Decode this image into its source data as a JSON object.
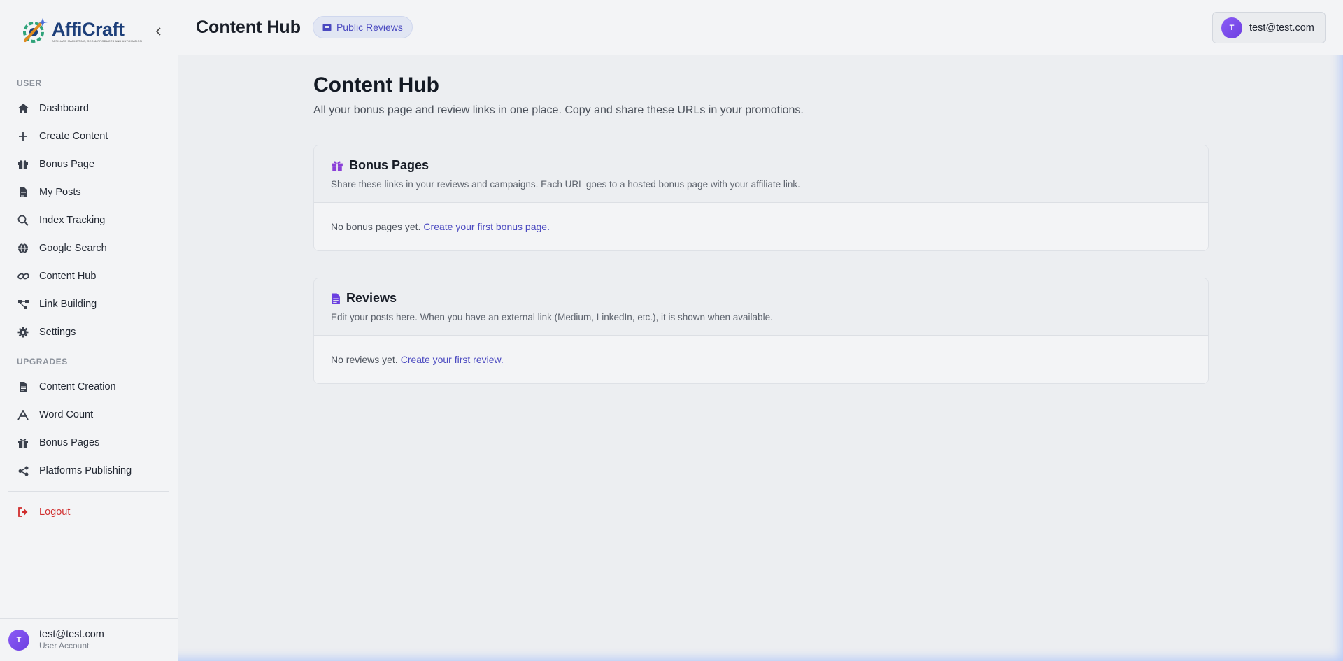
{
  "brand": {
    "name": "AffiCraft",
    "tagline": "AFFILIATE MARKETING, SEO & PRODUCTS AND AUTOMATION"
  },
  "sidebar": {
    "section_user": "USER",
    "items": [
      {
        "label": "Dashboard",
        "icon": "home-icon"
      },
      {
        "label": "Create Content",
        "icon": "plus-icon"
      },
      {
        "label": "Bonus Page",
        "icon": "gift-icon"
      },
      {
        "label": "My Posts",
        "icon": "document-icon"
      },
      {
        "label": "Index Tracking",
        "icon": "search-icon"
      },
      {
        "label": "Google Search",
        "icon": "globe-icon"
      },
      {
        "label": "Content Hub",
        "icon": "link-icon"
      },
      {
        "label": "Link Building",
        "icon": "network-icon"
      },
      {
        "label": "Settings",
        "icon": "gear-icon"
      }
    ],
    "section_upgrades": "UPGRADES",
    "upgrades": [
      {
        "label": "Content Creation",
        "icon": "document-icon"
      },
      {
        "label": "Word Count",
        "icon": "font-icon"
      },
      {
        "label": "Bonus Pages",
        "icon": "gift-icon"
      },
      {
        "label": "Platforms Publishing",
        "icon": "share-icon"
      }
    ],
    "logout": "Logout",
    "user": {
      "initial": "T",
      "email": "test@test.com",
      "role": "User Account"
    }
  },
  "header": {
    "title": "Content Hub",
    "pill_label": "Public Reviews",
    "account": {
      "initial": "T",
      "email": "test@test.com"
    }
  },
  "main": {
    "title": "Content Hub",
    "subtitle": "All your bonus page and review links in one place. Copy and share these URLs in your promotions.",
    "bonus": {
      "title": "Bonus Pages",
      "desc": "Share these links in your reviews and campaigns. Each URL goes to a hosted bonus page with your affiliate link.",
      "empty": "No bonus pages yet.",
      "cta": "Create your first bonus page."
    },
    "reviews": {
      "title": "Reviews",
      "desc": "Edit your posts here. When you have an external link (Medium, LinkedIn, etc.), it is shown when available.",
      "empty": "No reviews yet.",
      "cta": "Create your first review."
    }
  },
  "colors": {
    "accent": "#4a49c0",
    "avatar": "#7c4ddf",
    "logout": "#d02d2d",
    "brand_text": "#1d3f7a"
  }
}
